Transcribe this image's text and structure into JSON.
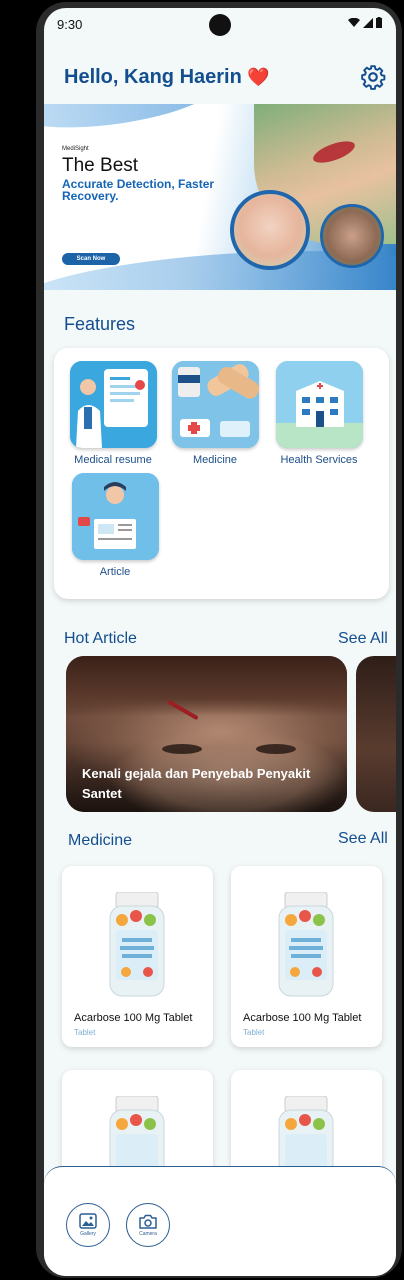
{
  "status_bar": {
    "time": "9:30"
  },
  "header": {
    "greeting": "Hello, Kang Haerin",
    "heart": "❤️"
  },
  "banner": {
    "brand": "MediSight",
    "headline": "The Best",
    "subheadline": "Accurate Detection, Faster Recovery.",
    "button": "Scan Now"
  },
  "features": {
    "title": "Features",
    "items": [
      {
        "label": "Medical resume",
        "icon": "medical-resume-icon"
      },
      {
        "label": "Medicine",
        "icon": "medicine-icon"
      },
      {
        "label": "Health Services",
        "icon": "hospital-icon"
      },
      {
        "label": "Article",
        "icon": "article-icon"
      }
    ]
  },
  "hot_article": {
    "title": "Hot Article",
    "see_all": "See All",
    "articles": [
      {
        "title": "Kenali gejala dan Penyebab Penyakit Santet"
      }
    ]
  },
  "medicine": {
    "title": "Medicine",
    "see_all": "See All",
    "items": [
      {
        "name": "Acarbose 100 Mg Tablet",
        "type": "Tablet"
      },
      {
        "name": "Acarbose 100 Mg Tablet",
        "type": "Tablet"
      },
      {
        "name": "",
        "type": ""
      },
      {
        "name": "",
        "type": ""
      }
    ]
  },
  "bottom_sheet": {
    "gallery": "Gallery",
    "camera": "Camera"
  },
  "colors": {
    "primary": "#134e8f",
    "accent": "#1565b5",
    "heart": "#e0262b"
  }
}
